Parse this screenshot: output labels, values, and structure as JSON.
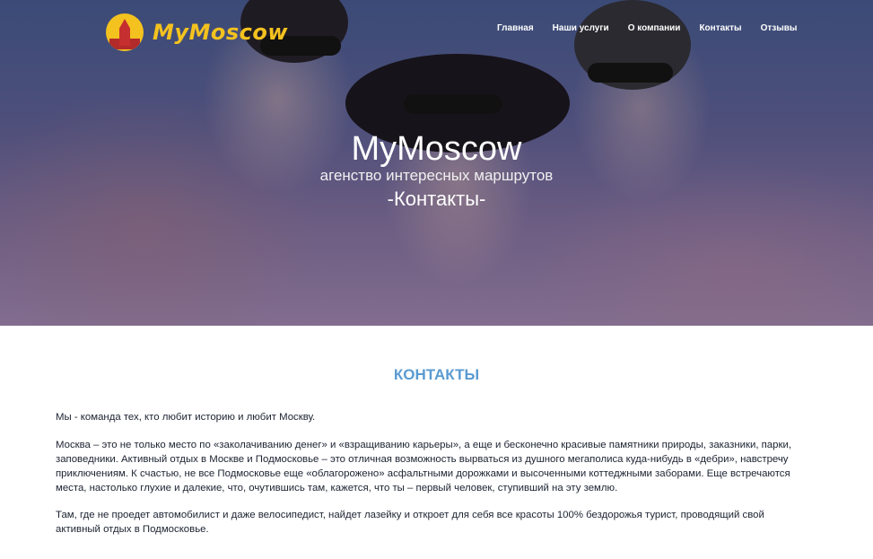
{
  "logo": {
    "text": "MyMoscow"
  },
  "nav": [
    {
      "label": "Главная"
    },
    {
      "label": "Наши услуги"
    },
    {
      "label": "О компании"
    },
    {
      "label": "Контакты"
    },
    {
      "label": "Отзывы"
    }
  ],
  "hero": {
    "title": "MyMoscow",
    "subtitle": "агенство интересных маршрутов",
    "page": "-Контакты-"
  },
  "section": {
    "title": "КОНТАКТЫ",
    "paragraphs": [
      "Мы - команда тех, кто любит историю и любит Москву.",
      "Москва – это не только место по «заколачиванию денег» и «взращиванию карьеры», а еще и бесконечно красивые памятники природы, заказники, парки, заповедники. Активный отдых в Москве и Подмосковье – это отличная возможность вырваться из душного мегаполиса куда-нибудь в «дебри», навстречу приключениям. К счастью, не все Подмосковье еще «облагорожено» асфальтными дорожками и высоченными коттеджными заборами. Еще встречаются места, настолько глухие и далекие, что, очутившись там, кажется, что ты – первый человек, ступивший на эту землю.",
      "Там, где не проедет автомобилист и даже велосипедист, найдет лазейку и откроет для себя все красоты 100% бездорожья турист, проводящий свой активный отдых в Подмосковье."
    ]
  },
  "colors": {
    "accent": "#5a9bd1",
    "logo": "#f4c21f",
    "text": "#1b2230"
  }
}
